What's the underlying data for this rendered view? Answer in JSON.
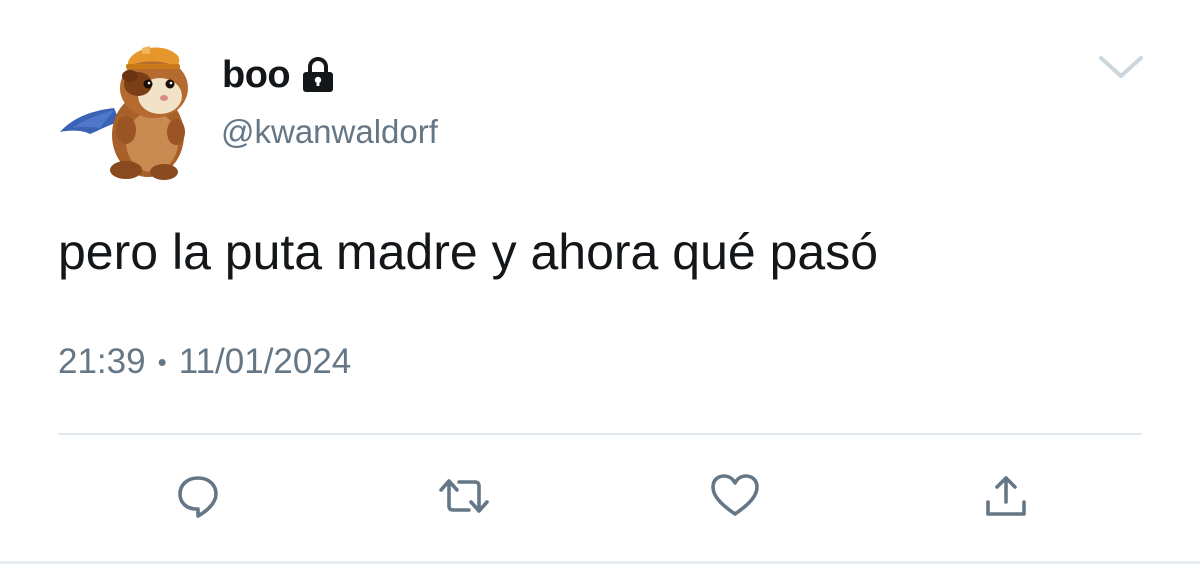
{
  "tweet": {
    "display_name": "boo",
    "handle": "@kwanwaldorf",
    "text": "pero la puta madre y ahora qué pasó",
    "time": "21:39",
    "separator": "•",
    "date": "11/01/2024",
    "protected_icon": "lock-icon",
    "menu_icon": "chevron-down-icon",
    "avatar": "guinea-pig-superhero-avatar"
  },
  "actions": [
    {
      "name": "reply",
      "icon": "reply-icon"
    },
    {
      "name": "retweet",
      "icon": "retweet-icon"
    },
    {
      "name": "like",
      "icon": "heart-icon"
    },
    {
      "name": "share",
      "icon": "share-icon"
    }
  ],
  "colors": {
    "text": "#14171a",
    "secondary": "#657786",
    "icon": "#657786",
    "divider": "#e1e8ed",
    "chevron": "#ccd6dd",
    "cape": "#3b63b5"
  }
}
